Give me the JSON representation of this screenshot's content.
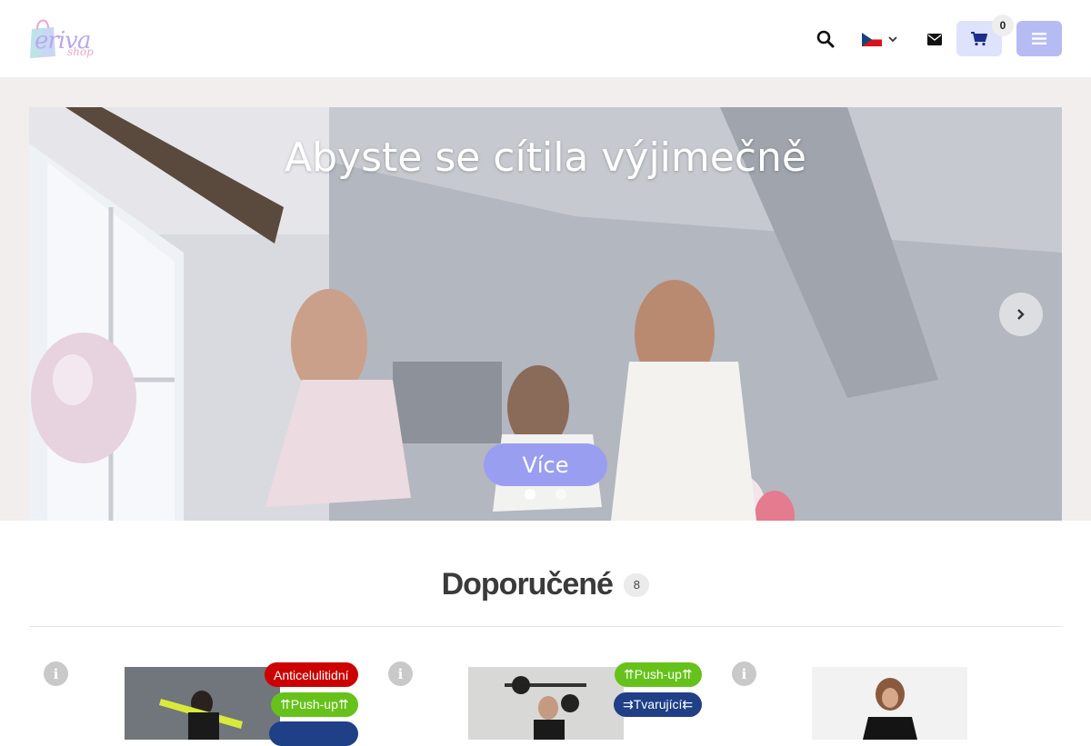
{
  "header": {
    "logo_text": "eriva",
    "logo_sub": "shop",
    "cart_count": "0",
    "language": "cs"
  },
  "hero": {
    "title": "Abyste se cítila výjimečně",
    "button_label": "Více",
    "active_slide": 1,
    "slide_count": 2
  },
  "section": {
    "title": "Doporučené",
    "count": "8"
  },
  "products": [
    {
      "badges": [
        "Anticelulitidní",
        "⇈Push-up⇈",
        ""
      ]
    },
    {
      "badges": [
        "⇈Push-up⇈",
        "⇉Tvarující⇇"
      ]
    },
    {
      "badges": []
    }
  ],
  "colors": {
    "accent": "#b7bbf3",
    "cart_bg": "#dfe2fb",
    "badge_red": "#cc0000",
    "badge_green": "#66c21a",
    "badge_navy": "#1f3f86"
  }
}
